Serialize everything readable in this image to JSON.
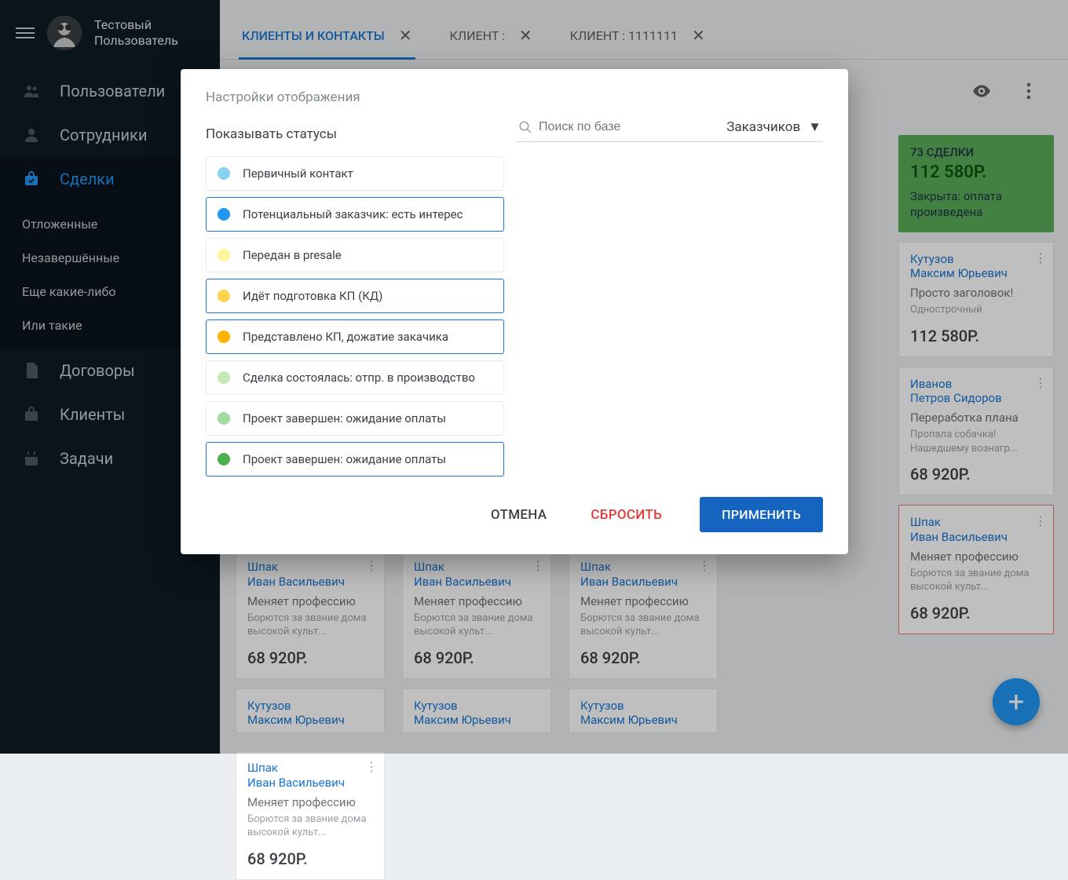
{
  "user": {
    "first": "Тестовый",
    "last": "Пользователь"
  },
  "sidebar": {
    "users": "Пользователи",
    "staff": "Сотрудники",
    "deals": "Сделки",
    "filters": [
      "Отложенные",
      "Незавершённые",
      "Еще какие-либо",
      "Или такие"
    ],
    "contracts": "Договоры",
    "clients": "Клиенты",
    "tasks": "Задачи"
  },
  "tabs": [
    {
      "label": "КЛИЕНТЫ И КОНТАКТЫ",
      "active": true
    },
    {
      "label": "КЛИЕНТ :",
      "active": false
    },
    {
      "label": "КЛИЕНТ : 1111111",
      "active": false
    }
  ],
  "summary": {
    "count": "73 СДЕЛКИ",
    "amount": "112 580P.",
    "status": "Закрыта: оплата произведена"
  },
  "side_cards": [
    {
      "last": "Кутузов",
      "first": "Максим Юрьевич",
      "title": "Просто заголовок!",
      "sub": "Однострочный",
      "price": "112 580P."
    },
    {
      "last": "Иванов",
      "first": "Петров Сидоров",
      "title": "Переработка плана",
      "sub": "Пропала собачка! Нашедшему вознагр...",
      "price": "68 920P."
    },
    {
      "last": "Шпак",
      "first": "Иван Васильевич",
      "title": "Меняет профессию",
      "sub": "Борются за звание дома высокой культ...",
      "price": "68 920P.",
      "red": true
    }
  ],
  "bg_card": {
    "last": "Шпак",
    "first": "Иван Васильевич",
    "title": "Меняет профессию",
    "sub": "Борются за звание дома высокой культ...",
    "price": "68 920P."
  },
  "bg_card2": {
    "last": "Кутузов",
    "first": "Максим Юрьевич"
  },
  "dialog": {
    "title": "Настройки отображения",
    "subtitle": "Показывать статусы",
    "search_placeholder": "Поиск по базе",
    "dropdown": "Заказчиков",
    "statuses": [
      {
        "label": "Первичный контакт",
        "color": "#8ad0f0",
        "selected": false
      },
      {
        "label": "Потенциальный заказчик: есть интерес",
        "color": "#2196f3",
        "selected": true
      },
      {
        "label": "Передан в presale",
        "color": "#fff59b",
        "selected": false
      },
      {
        "label": "Идёт подготовка КП (КД)",
        "color": "#ffd54f",
        "selected": true
      },
      {
        "label": "Представлено КП, дожатие закачика",
        "color": "#ffb300",
        "selected": true
      },
      {
        "label": "Сделка состоялась: отпр. в производство",
        "color": "#c5e8b7",
        "selected": false
      },
      {
        "label": "Проект завершен: ожидание оплаты",
        "color": "#a0dca0",
        "selected": false
      },
      {
        "label": "Проект завершен: ожидание оплаты",
        "color": "#4caf50",
        "selected": true
      }
    ],
    "cancel": "ОТМЕНА",
    "reset": "СБРОСИТЬ",
    "apply": "ПРИМЕНИТЬ"
  }
}
